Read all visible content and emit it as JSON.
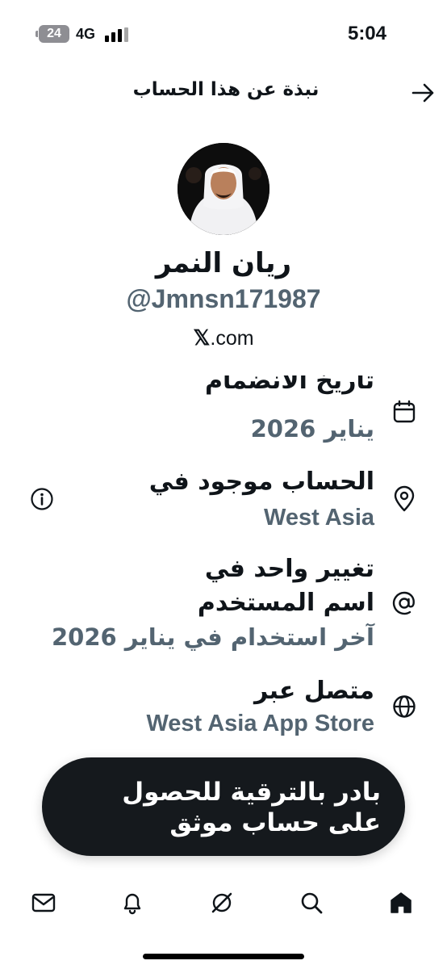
{
  "status_bar": {
    "battery": "24",
    "network": "4G",
    "time": "5:04"
  },
  "header": {
    "title": "نبذة عن هذا الحساب",
    "back_icon": "arrow-right-icon"
  },
  "profile": {
    "display_name": "ريان النمر",
    "handle": "@Jmnsn171987",
    "domain_mark": "𝕏",
    "domain_suffix": ".com"
  },
  "info_rows": [
    {
      "icon": "calendar-icon",
      "title": "تاريخ الانضمام",
      "value": "يناير 2026"
    },
    {
      "icon": "location-pin-icon",
      "title": "الحساب موجود في",
      "value": "West Asia",
      "has_info_button": true
    },
    {
      "icon": "at-sign-icon",
      "title_line1": "تغيير واحد في",
      "title_line2": "اسم المستخدم",
      "value": "آخر استخدام في يناير 2026"
    },
    {
      "icon": "globe-icon",
      "title": "متصل عبر",
      "value": "West Asia App Store"
    }
  ],
  "subscribe_banner": {
    "text": "بادر بالترقية للحصول على حساب موثق"
  },
  "tab_bar": [
    {
      "icon": "mail-icon"
    },
    {
      "icon": "bell-icon"
    },
    {
      "icon": "grok-icon"
    },
    {
      "icon": "search-icon"
    },
    {
      "icon": "home-icon",
      "active": true
    }
  ]
}
